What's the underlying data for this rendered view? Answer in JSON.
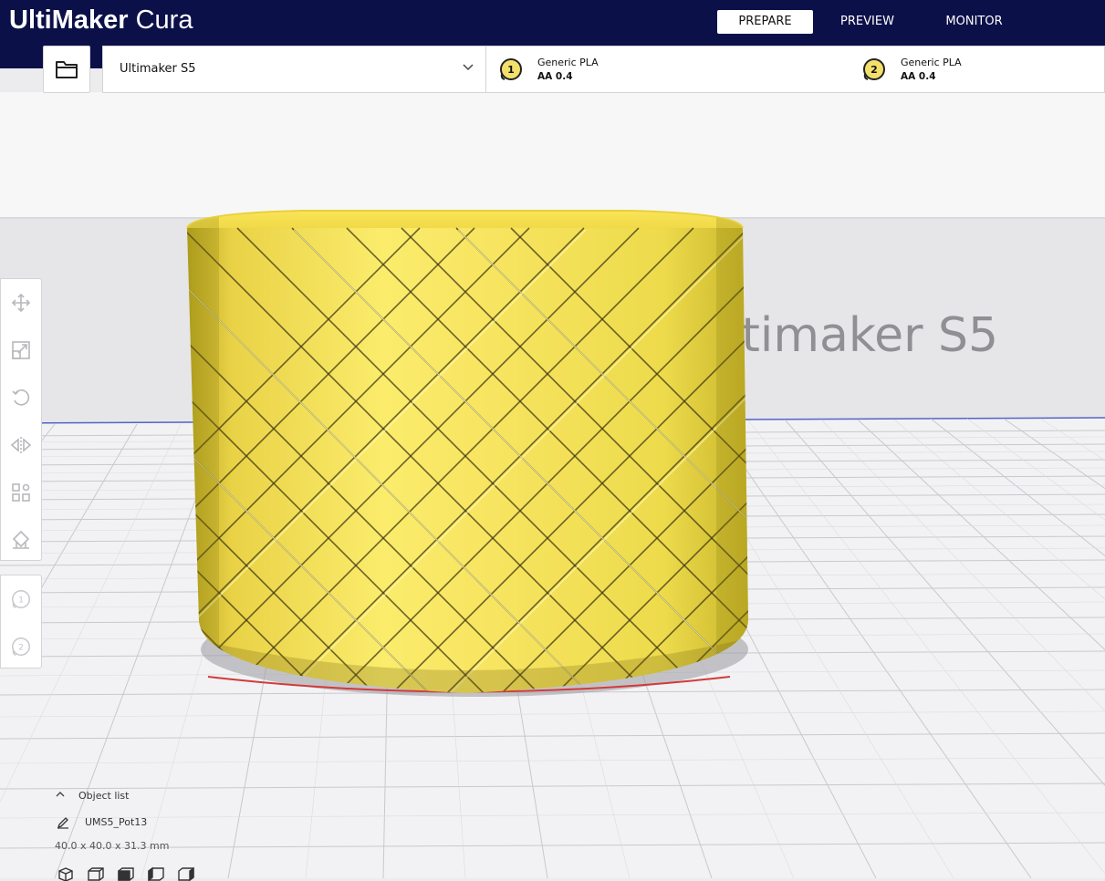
{
  "app": {
    "logo_bold": "UltiMaker",
    "logo_light": "Cura"
  },
  "stages": [
    {
      "label": "PREPARE",
      "active": true
    },
    {
      "label": "PREVIEW",
      "active": false
    },
    {
      "label": "MONITOR",
      "active": false
    }
  ],
  "printer": {
    "name": "Ultimaker S5"
  },
  "extruders": [
    {
      "number": "1",
      "material": "Generic PLA",
      "nozzle": "AA 0.4"
    },
    {
      "number": "2",
      "material": "Generic PLA",
      "nozzle": "AA 0.4"
    }
  ],
  "build_plate": {
    "label": "Ultimaker S5",
    "visible_fragment": "r S5"
  },
  "tools": [
    {
      "name": "move-icon"
    },
    {
      "name": "scale-icon"
    },
    {
      "name": "rotate-icon"
    },
    {
      "name": "mirror-icon"
    },
    {
      "name": "per-model-settings-icon"
    },
    {
      "name": "support-blocker-icon"
    }
  ],
  "object_list": {
    "header": "Object list",
    "object_name": "UMS5_Pot13",
    "dimensions": "40.0 x 40.0 x 31.3 mm",
    "view_icons": [
      "3d-view-icon",
      "front-view-icon",
      "top-view-icon",
      "left-view-icon",
      "right-view-icon"
    ]
  },
  "colors": {
    "header_bg": "#0c1049",
    "model_yellow": "#f6e35a",
    "accent_blue": "#2a3fb3"
  }
}
